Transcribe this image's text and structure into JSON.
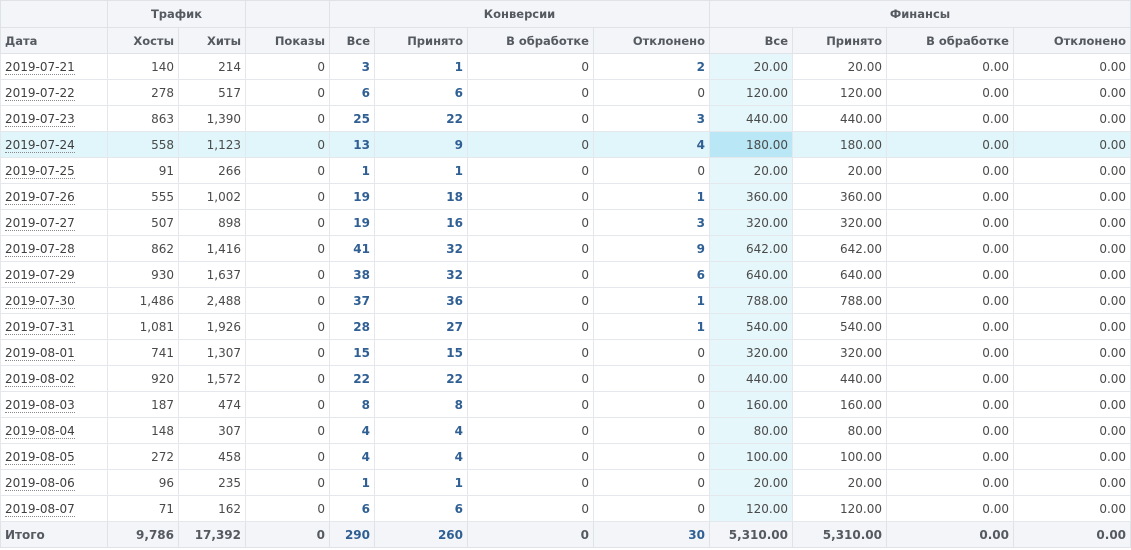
{
  "groups": {
    "traffic": "Трафик",
    "conversions": "Конверсии",
    "finance": "Финансы"
  },
  "columns": {
    "date": "Дата",
    "hosts": "Хосты",
    "hits": "Хиты",
    "shows": "Показы",
    "conv_all": "Все",
    "conv_accepted": "Принято",
    "conv_processing": "В обработке",
    "conv_rejected": "Отклонено",
    "fin_all": "Все",
    "fin_accepted": "Принято",
    "fin_processing": "В обработке",
    "fin_rejected": "Отклонено"
  },
  "highlighted_row": 3,
  "rows": [
    {
      "date": "2019-07-21",
      "hosts": "140",
      "hits": "214",
      "shows": "0",
      "conv_all": "3",
      "conv_accepted": "1",
      "conv_processing": "0",
      "conv_rejected": "2",
      "fin_all": "20.00",
      "fin_accepted": "20.00",
      "fin_processing": "0.00",
      "fin_rejected": "0.00"
    },
    {
      "date": "2019-07-22",
      "hosts": "278",
      "hits": "517",
      "shows": "0",
      "conv_all": "6",
      "conv_accepted": "6",
      "conv_processing": "0",
      "conv_rejected": "0",
      "fin_all": "120.00",
      "fin_accepted": "120.00",
      "fin_processing": "0.00",
      "fin_rejected": "0.00"
    },
    {
      "date": "2019-07-23",
      "hosts": "863",
      "hits": "1,390",
      "shows": "0",
      "conv_all": "25",
      "conv_accepted": "22",
      "conv_processing": "0",
      "conv_rejected": "3",
      "fin_all": "440.00",
      "fin_accepted": "440.00",
      "fin_processing": "0.00",
      "fin_rejected": "0.00"
    },
    {
      "date": "2019-07-24",
      "hosts": "558",
      "hits": "1,123",
      "shows": "0",
      "conv_all": "13",
      "conv_accepted": "9",
      "conv_processing": "0",
      "conv_rejected": "4",
      "fin_all": "180.00",
      "fin_accepted": "180.00",
      "fin_processing": "0.00",
      "fin_rejected": "0.00"
    },
    {
      "date": "2019-07-25",
      "hosts": "91",
      "hits": "266",
      "shows": "0",
      "conv_all": "1",
      "conv_accepted": "1",
      "conv_processing": "0",
      "conv_rejected": "0",
      "fin_all": "20.00",
      "fin_accepted": "20.00",
      "fin_processing": "0.00",
      "fin_rejected": "0.00"
    },
    {
      "date": "2019-07-26",
      "hosts": "555",
      "hits": "1,002",
      "shows": "0",
      "conv_all": "19",
      "conv_accepted": "18",
      "conv_processing": "0",
      "conv_rejected": "1",
      "fin_all": "360.00",
      "fin_accepted": "360.00",
      "fin_processing": "0.00",
      "fin_rejected": "0.00"
    },
    {
      "date": "2019-07-27",
      "hosts": "507",
      "hits": "898",
      "shows": "0",
      "conv_all": "19",
      "conv_accepted": "16",
      "conv_processing": "0",
      "conv_rejected": "3",
      "fin_all": "320.00",
      "fin_accepted": "320.00",
      "fin_processing": "0.00",
      "fin_rejected": "0.00"
    },
    {
      "date": "2019-07-28",
      "hosts": "862",
      "hits": "1,416",
      "shows": "0",
      "conv_all": "41",
      "conv_accepted": "32",
      "conv_processing": "0",
      "conv_rejected": "9",
      "fin_all": "642.00",
      "fin_accepted": "642.00",
      "fin_processing": "0.00",
      "fin_rejected": "0.00"
    },
    {
      "date": "2019-07-29",
      "hosts": "930",
      "hits": "1,637",
      "shows": "0",
      "conv_all": "38",
      "conv_accepted": "32",
      "conv_processing": "0",
      "conv_rejected": "6",
      "fin_all": "640.00",
      "fin_accepted": "640.00",
      "fin_processing": "0.00",
      "fin_rejected": "0.00"
    },
    {
      "date": "2019-07-30",
      "hosts": "1,486",
      "hits": "2,488",
      "shows": "0",
      "conv_all": "37",
      "conv_accepted": "36",
      "conv_processing": "0",
      "conv_rejected": "1",
      "fin_all": "788.00",
      "fin_accepted": "788.00",
      "fin_processing": "0.00",
      "fin_rejected": "0.00"
    },
    {
      "date": "2019-07-31",
      "hosts": "1,081",
      "hits": "1,926",
      "shows": "0",
      "conv_all": "28",
      "conv_accepted": "27",
      "conv_processing": "0",
      "conv_rejected": "1",
      "fin_all": "540.00",
      "fin_accepted": "540.00",
      "fin_processing": "0.00",
      "fin_rejected": "0.00"
    },
    {
      "date": "2019-08-01",
      "hosts": "741",
      "hits": "1,307",
      "shows": "0",
      "conv_all": "15",
      "conv_accepted": "15",
      "conv_processing": "0",
      "conv_rejected": "0",
      "fin_all": "320.00",
      "fin_accepted": "320.00",
      "fin_processing": "0.00",
      "fin_rejected": "0.00"
    },
    {
      "date": "2019-08-02",
      "hosts": "920",
      "hits": "1,572",
      "shows": "0",
      "conv_all": "22",
      "conv_accepted": "22",
      "conv_processing": "0",
      "conv_rejected": "0",
      "fin_all": "440.00",
      "fin_accepted": "440.00",
      "fin_processing": "0.00",
      "fin_rejected": "0.00"
    },
    {
      "date": "2019-08-03",
      "hosts": "187",
      "hits": "474",
      "shows": "0",
      "conv_all": "8",
      "conv_accepted": "8",
      "conv_processing": "0",
      "conv_rejected": "0",
      "fin_all": "160.00",
      "fin_accepted": "160.00",
      "fin_processing": "0.00",
      "fin_rejected": "0.00"
    },
    {
      "date": "2019-08-04",
      "hosts": "148",
      "hits": "307",
      "shows": "0",
      "conv_all": "4",
      "conv_accepted": "4",
      "conv_processing": "0",
      "conv_rejected": "0",
      "fin_all": "80.00",
      "fin_accepted": "80.00",
      "fin_processing": "0.00",
      "fin_rejected": "0.00"
    },
    {
      "date": "2019-08-05",
      "hosts": "272",
      "hits": "458",
      "shows": "0",
      "conv_all": "4",
      "conv_accepted": "4",
      "conv_processing": "0",
      "conv_rejected": "0",
      "fin_all": "100.00",
      "fin_accepted": "100.00",
      "fin_processing": "0.00",
      "fin_rejected": "0.00"
    },
    {
      "date": "2019-08-06",
      "hosts": "96",
      "hits": "235",
      "shows": "0",
      "conv_all": "1",
      "conv_accepted": "1",
      "conv_processing": "0",
      "conv_rejected": "0",
      "fin_all": "20.00",
      "fin_accepted": "20.00",
      "fin_processing": "0.00",
      "fin_rejected": "0.00"
    },
    {
      "date": "2019-08-07",
      "hosts": "71",
      "hits": "162",
      "shows": "0",
      "conv_all": "6",
      "conv_accepted": "6",
      "conv_processing": "0",
      "conv_rejected": "0",
      "fin_all": "120.00",
      "fin_accepted": "120.00",
      "fin_processing": "0.00",
      "fin_rejected": "0.00"
    }
  ],
  "totals": {
    "label": "Итого",
    "hosts": "9,786",
    "hits": "17,392",
    "shows": "0",
    "conv_all": "290",
    "conv_accepted": "260",
    "conv_processing": "0",
    "conv_rejected": "30",
    "fin_all": "5,310.00",
    "fin_accepted": "5,310.00",
    "fin_processing": "0.00",
    "fin_rejected": "0.00"
  }
}
